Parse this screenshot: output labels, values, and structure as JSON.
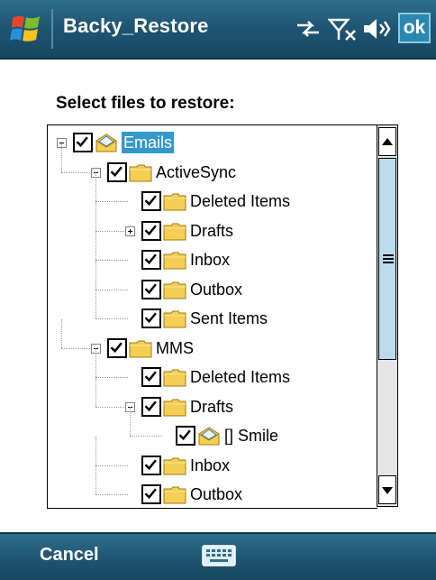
{
  "titlebar": {
    "title": "Backy_Restore",
    "ok_label": "ok",
    "icons": [
      "windows-start-icon",
      "connectivity-icon",
      "no-signal-icon",
      "volume-icon"
    ]
  },
  "heading": "Select files to restore:",
  "tree": [
    {
      "label": "Emails",
      "level": 0,
      "icon": "envelope-icon",
      "expander": "minus",
      "selected": true,
      "checked": true
    },
    {
      "label": "ActiveSync",
      "level": 1,
      "icon": "folder-icon",
      "expander": "minus",
      "checked": true
    },
    {
      "label": "Deleted Items",
      "level": 2,
      "icon": "folder-icon",
      "expander": "none",
      "checked": true
    },
    {
      "label": "Drafts",
      "level": 2,
      "icon": "folder-icon",
      "expander": "plus",
      "checked": true
    },
    {
      "label": "Inbox",
      "level": 2,
      "icon": "folder-icon",
      "expander": "none",
      "checked": true
    },
    {
      "label": "Outbox",
      "level": 2,
      "icon": "folder-icon",
      "expander": "none",
      "checked": true
    },
    {
      "label": "Sent Items",
      "level": 2,
      "icon": "folder-icon",
      "expander": "none",
      "checked": true
    },
    {
      "label": "MMS",
      "level": 1,
      "icon": "folder-icon",
      "expander": "minus",
      "checked": true
    },
    {
      "label": "Deleted Items",
      "level": 2,
      "icon": "folder-icon",
      "expander": "none",
      "checked": true
    },
    {
      "label": "Drafts",
      "level": 2,
      "icon": "folder-icon",
      "expander": "minus",
      "checked": true
    },
    {
      "label": "[] Smile",
      "level": 3,
      "icon": "envelope-icon",
      "expander": "none",
      "checked": true
    },
    {
      "label": "Inbox",
      "level": 2,
      "icon": "folder-icon",
      "expander": "none",
      "checked": true
    },
    {
      "label": "Outbox",
      "level": 2,
      "icon": "folder-icon",
      "expander": "none",
      "checked": true
    }
  ],
  "softkeys": {
    "left": "Cancel",
    "center_icon": "keyboard-icon"
  },
  "colors": {
    "titlebar": "#1f5673",
    "selection": "#3399cc",
    "scroll_thumb": "#bcdceb",
    "folder": "#f4cf54"
  }
}
